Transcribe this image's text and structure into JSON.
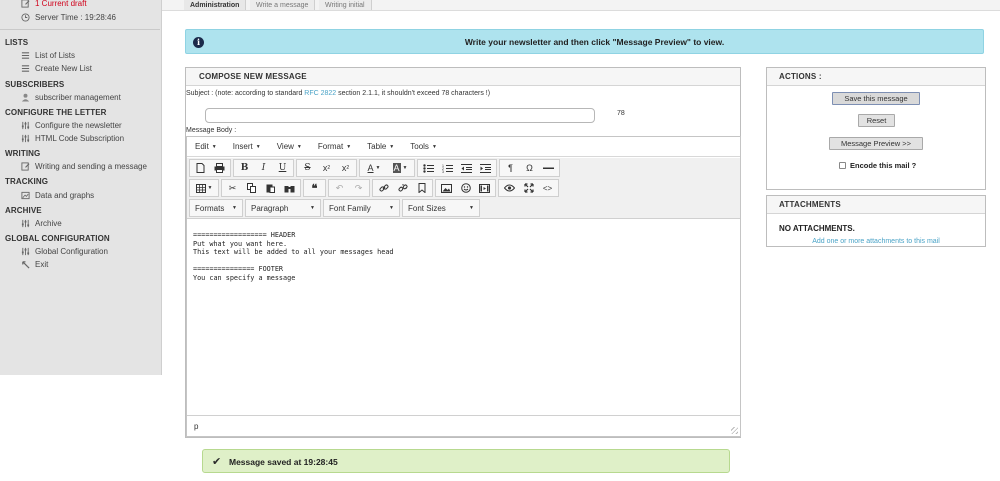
{
  "sidebar": {
    "draft_label": "1 Current draft",
    "server_time": "Server Time : 19:28:46",
    "sections": [
      {
        "heading": "LISTS",
        "items": [
          "List of Lists",
          "Create New List"
        ]
      },
      {
        "heading": "SUBSCRIBERS",
        "items": [
          "subscriber management"
        ]
      },
      {
        "heading": "CONFIGURE THE LETTER",
        "items": [
          "Configure the newsletter",
          "HTML Code Subscription"
        ]
      },
      {
        "heading": "WRITING",
        "items": [
          "Writing and sending a message"
        ]
      },
      {
        "heading": "TRACKING",
        "items": [
          "Data and graphs"
        ]
      },
      {
        "heading": "ARCHIVE",
        "items": [
          "Archive"
        ]
      },
      {
        "heading": "GLOBAL CONFIGURATION",
        "items": [
          "Global Configuration",
          "Exit"
        ]
      }
    ]
  },
  "breadcrumb": [
    "Administration",
    "Write a message",
    "Writing initial"
  ],
  "info": {
    "text": "Write your newsletter and then click \"Message Preview\" to view."
  },
  "compose": {
    "title": "COMPOSE NEW MESSAGE",
    "subject_note_pre": "Subject : (note: according to standard ",
    "subject_note_link": "RFC 2822",
    "subject_note_post": " section 2.1.1, it shouldn't exceed 78 characters !)",
    "subject_value": "",
    "char_count": "78",
    "body_label": "Message Body :",
    "menus": [
      "Edit",
      "Insert",
      "View",
      "Format",
      "Table",
      "Tools"
    ],
    "dropdowns": [
      "Formats",
      "Paragraph",
      "Font Family",
      "Font Sizes"
    ],
    "content": "================== HEADER\nPut what you want here.\nThis text will be added to all your messages head\n\n=============== FOOTER\nYou can specify a message",
    "status_path": "p"
  },
  "saved": {
    "text": "Message saved at 19:28:45"
  },
  "actions": {
    "title": "ACTIONS :",
    "save": "Save this message",
    "reset": "Reset",
    "preview": "Message Preview >>",
    "encode": "Encode this mail ?"
  },
  "attachments": {
    "title": "ATTACHMENTS",
    "none": "NO ATTACHMENTS.",
    "add": "Add one or more attachments to this mail"
  }
}
